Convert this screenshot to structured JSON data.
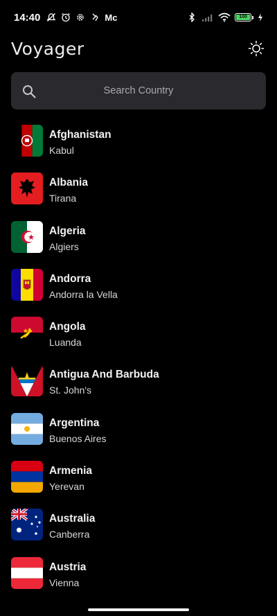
{
  "status_bar": {
    "time": "14:40",
    "carrier_text": "Mc",
    "battery_level": "100"
  },
  "app": {
    "title": "Voyager"
  },
  "search": {
    "placeholder": "Search Country"
  },
  "countries": [
    {
      "name": "Afghanistan",
      "capital": "Kabul"
    },
    {
      "name": "Albania",
      "capital": "Tirana"
    },
    {
      "name": "Algeria",
      "capital": "Algiers"
    },
    {
      "name": "Andorra",
      "capital": "Andorra la Vella"
    },
    {
      "name": "Angola",
      "capital": "Luanda"
    },
    {
      "name": "Antigua And Barbuda",
      "capital": "St. John's"
    },
    {
      "name": "Argentina",
      "capital": "Buenos Aires"
    },
    {
      "name": "Armenia",
      "capital": "Yerevan"
    },
    {
      "name": "Australia",
      "capital": "Canberra"
    },
    {
      "name": "Austria",
      "capital": "Vienna"
    }
  ],
  "colors": {
    "background": "#000000",
    "search_background": "#2a2a2e",
    "battery": "#4cd964"
  }
}
